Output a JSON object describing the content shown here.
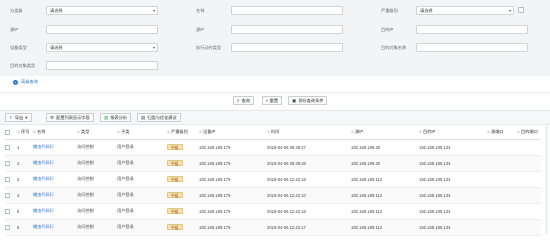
{
  "filters": {
    "row1": [
      {
        "label": "分类级",
        "value": "请选择",
        "type": "select"
      },
      {
        "label": "名称",
        "value": "",
        "type": "input"
      },
      {
        "label": "严重级别",
        "value": "请选择",
        "type": "select"
      }
    ],
    "row2": [
      {
        "label": "源IP",
        "value": ""
      },
      {
        "label": "源IP",
        "value": ""
      },
      {
        "label": "目的IP",
        "value": ""
      }
    ],
    "row3": [
      {
        "label": "设备类型",
        "value": "请选择",
        "type": "select"
      },
      {
        "label": "执行动作类型",
        "value": ""
      },
      {
        "label": "目的对象名称",
        "value": ""
      }
    ],
    "row4": [
      {
        "label": "目的对象类型",
        "value": ""
      }
    ]
  },
  "advanced_label": "高级查询",
  "actions": {
    "query": "查询",
    "reset": "重置",
    "save": "保存查询条件"
  },
  "toolbar": {
    "export": "导出",
    "config_columns": "配置列表显示字段",
    "report": "报表分析",
    "suggest": "归类与优化建议"
  },
  "table": {
    "headers": [
      "序号",
      "名称",
      "类型",
      "子类",
      "严重级别",
      "设备IP",
      "时间",
      "源IP",
      "目的IP",
      "源端口",
      "目的端口"
    ],
    "rows": [
      {
        "no": "1",
        "name": "蠕虫代码行",
        "type": "访问控制",
        "sub": "用户登录",
        "sev": "中级",
        "dev": "192.168.199.179",
        "time": "2018-04-06 09:39:27",
        "src": "192.168.199.30",
        "dst": "192.168.199.134",
        "sport": "",
        "dport": ""
      },
      {
        "no": "2",
        "name": "蠕虫代码行",
        "type": "访问控制",
        "sub": "用户登录",
        "sev": "中级",
        "dev": "192.168.199.179",
        "time": "2018-04-06 09:39:26",
        "src": "192.168.199.30",
        "dst": "192.168.199.134",
        "sport": "",
        "dport": ""
      },
      {
        "no": "3",
        "name": "蠕虫代码行",
        "type": "访问控制",
        "sub": "用户登录",
        "sev": "中级",
        "dev": "192.168.199.179",
        "time": "2018-04-06 12:42:16",
        "src": "192.168.199.112",
        "dst": "192.168.199.134",
        "sport": "",
        "dport": ""
      },
      {
        "no": "4",
        "name": "蠕虫代码行",
        "type": "访问控制",
        "sub": "用户登录",
        "sev": "中级",
        "dev": "192.168.199.179",
        "time": "2018-04-06 12:42:10",
        "src": "192.168.199.112",
        "dst": "192.168.199.134",
        "sport": "",
        "dport": ""
      },
      {
        "no": "5",
        "name": "蠕虫代码行",
        "type": "访问控制",
        "sub": "用户登录",
        "sev": "中级",
        "dev": "192.168.199.179",
        "time": "2018-04-06 12:42:16",
        "src": "192.168.199.112",
        "dst": "192.168.199.134",
        "sport": "",
        "dport": ""
      },
      {
        "no": "6",
        "name": "蠕虫代码行",
        "type": "访问控制",
        "sub": "用户登录",
        "sev": "中级",
        "dev": "192.168.199.179",
        "time": "2018-04-06 12:42:17",
        "src": "192.168.199.112",
        "dst": "192.168.199.134",
        "sport": "",
        "dport": ""
      }
    ]
  },
  "colors": {
    "accent": "#2b78c5",
    "severity_bg": "#f6e2b3"
  }
}
